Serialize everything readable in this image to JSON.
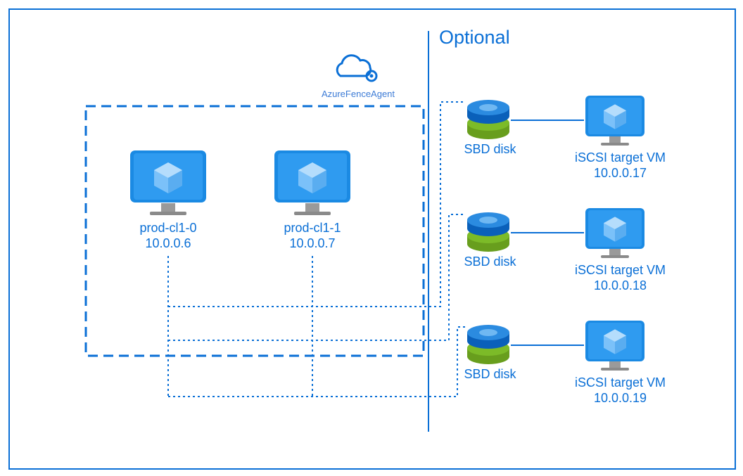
{
  "fence_agent_label": "AzureFenceAgent",
  "optional_label": "Optional",
  "cluster_nodes": [
    {
      "name": "prod-cl1-0",
      "ip": "10.0.0.6"
    },
    {
      "name": "prod-cl1-1",
      "ip": "10.0.0.7"
    }
  ],
  "sbd_disk_label": "SBD disk",
  "iscsi_targets": [
    {
      "title": "iSCSI target VM",
      "ip": "10.0.0.17"
    },
    {
      "title": "iSCSI target VM",
      "ip": "10.0.0.18"
    },
    {
      "title": "iSCSI target VM",
      "ip": "10.0.0.19"
    }
  ],
  "colors": {
    "blue": "#0a6fd6",
    "lightblue": "#52a9f5",
    "dark": "#0847a8",
    "green_dark": "#689e1d",
    "green_light": "#7cbb28",
    "grey": "#7a7a7a"
  }
}
